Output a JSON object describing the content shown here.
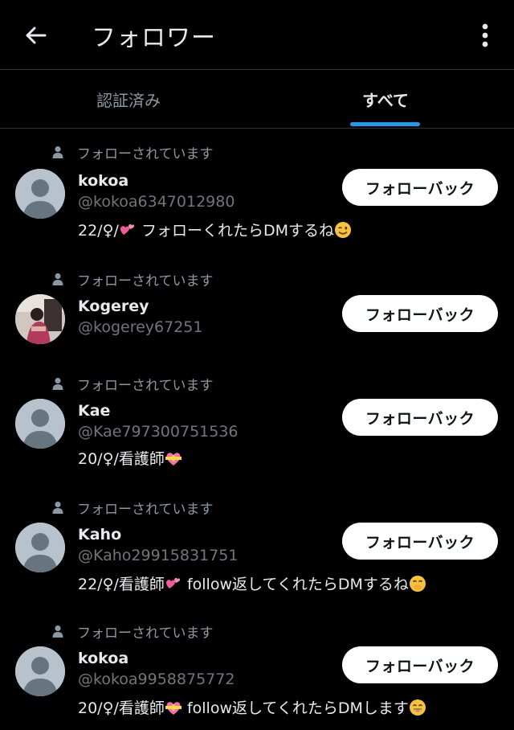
{
  "header": {
    "title": "フォロワー"
  },
  "tabs": {
    "verified": "認証済み",
    "all": "すべて"
  },
  "colors": {
    "accent": "#1d9bf0",
    "background": "#000000",
    "secondary_text": "#71767b"
  },
  "follower_rows": [
    {
      "follows_you": "フォローされています",
      "name": "kokoa",
      "handle": "@kokoa6347012980",
      "bio": "22/♀/",
      "bio_rest": " フォローくれたらDMするね",
      "button": "フォローバック",
      "avatar": "default"
    },
    {
      "follows_you": "フォローされています",
      "name": "Kogerey",
      "handle": "@kogerey67251",
      "bio": "",
      "bio_rest": "",
      "button": "フォローバック",
      "avatar": "photo"
    },
    {
      "follows_you": "フォローされています",
      "name": "Kae",
      "handle": "@Kae797300751536",
      "bio": "20/♀/看護師",
      "bio_rest": "",
      "button": "フォローバック",
      "avatar": "default"
    },
    {
      "follows_you": "フォローされています",
      "name": "Kaho",
      "handle": "@Kaho29915831751",
      "bio": "22/♀/看護師",
      "bio_rest": " follow返してくれたらDMするね",
      "button": "フォローバック",
      "avatar": "default"
    },
    {
      "follows_you": "フォローされています",
      "name": "kokoa",
      "handle": "@kokoa9958875772",
      "bio": "20/♀/看護師",
      "bio_rest": " follow返してくれたらDMします",
      "button": "フォローバック",
      "avatar": "default"
    }
  ]
}
